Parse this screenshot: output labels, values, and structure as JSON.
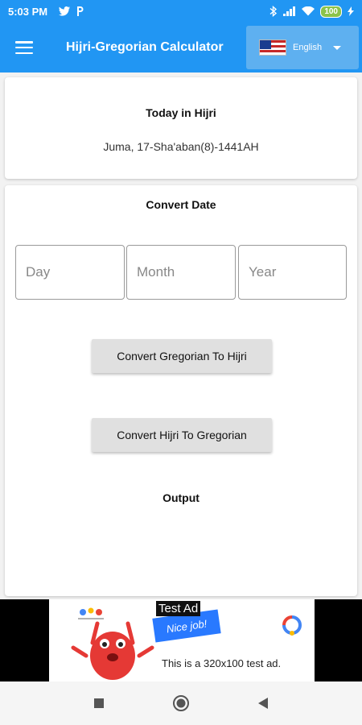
{
  "status_bar": {
    "time": "5:03 PM",
    "battery": "100"
  },
  "app_bar": {
    "title": "Hijri-Gregorian Calculator",
    "language": "English"
  },
  "today": {
    "title": "Today in Hijri",
    "value": "Juma, 17-Sha'aban(8)-1441AH"
  },
  "convert": {
    "title": "Convert Date",
    "day_placeholder": "Day",
    "month_placeholder": "Month",
    "year_placeholder": "Year",
    "g2h_label": "Convert Gregorian To Hijri",
    "h2g_label": "Convert Hijri To Gregorian",
    "output_label": "Output"
  },
  "ad": {
    "tag": "Test Ad",
    "nice": "Nice job!",
    "body": "This is a 320x100 test ad."
  },
  "colors": {
    "primary": "#2196f3",
    "button": "#e0e0e0"
  }
}
